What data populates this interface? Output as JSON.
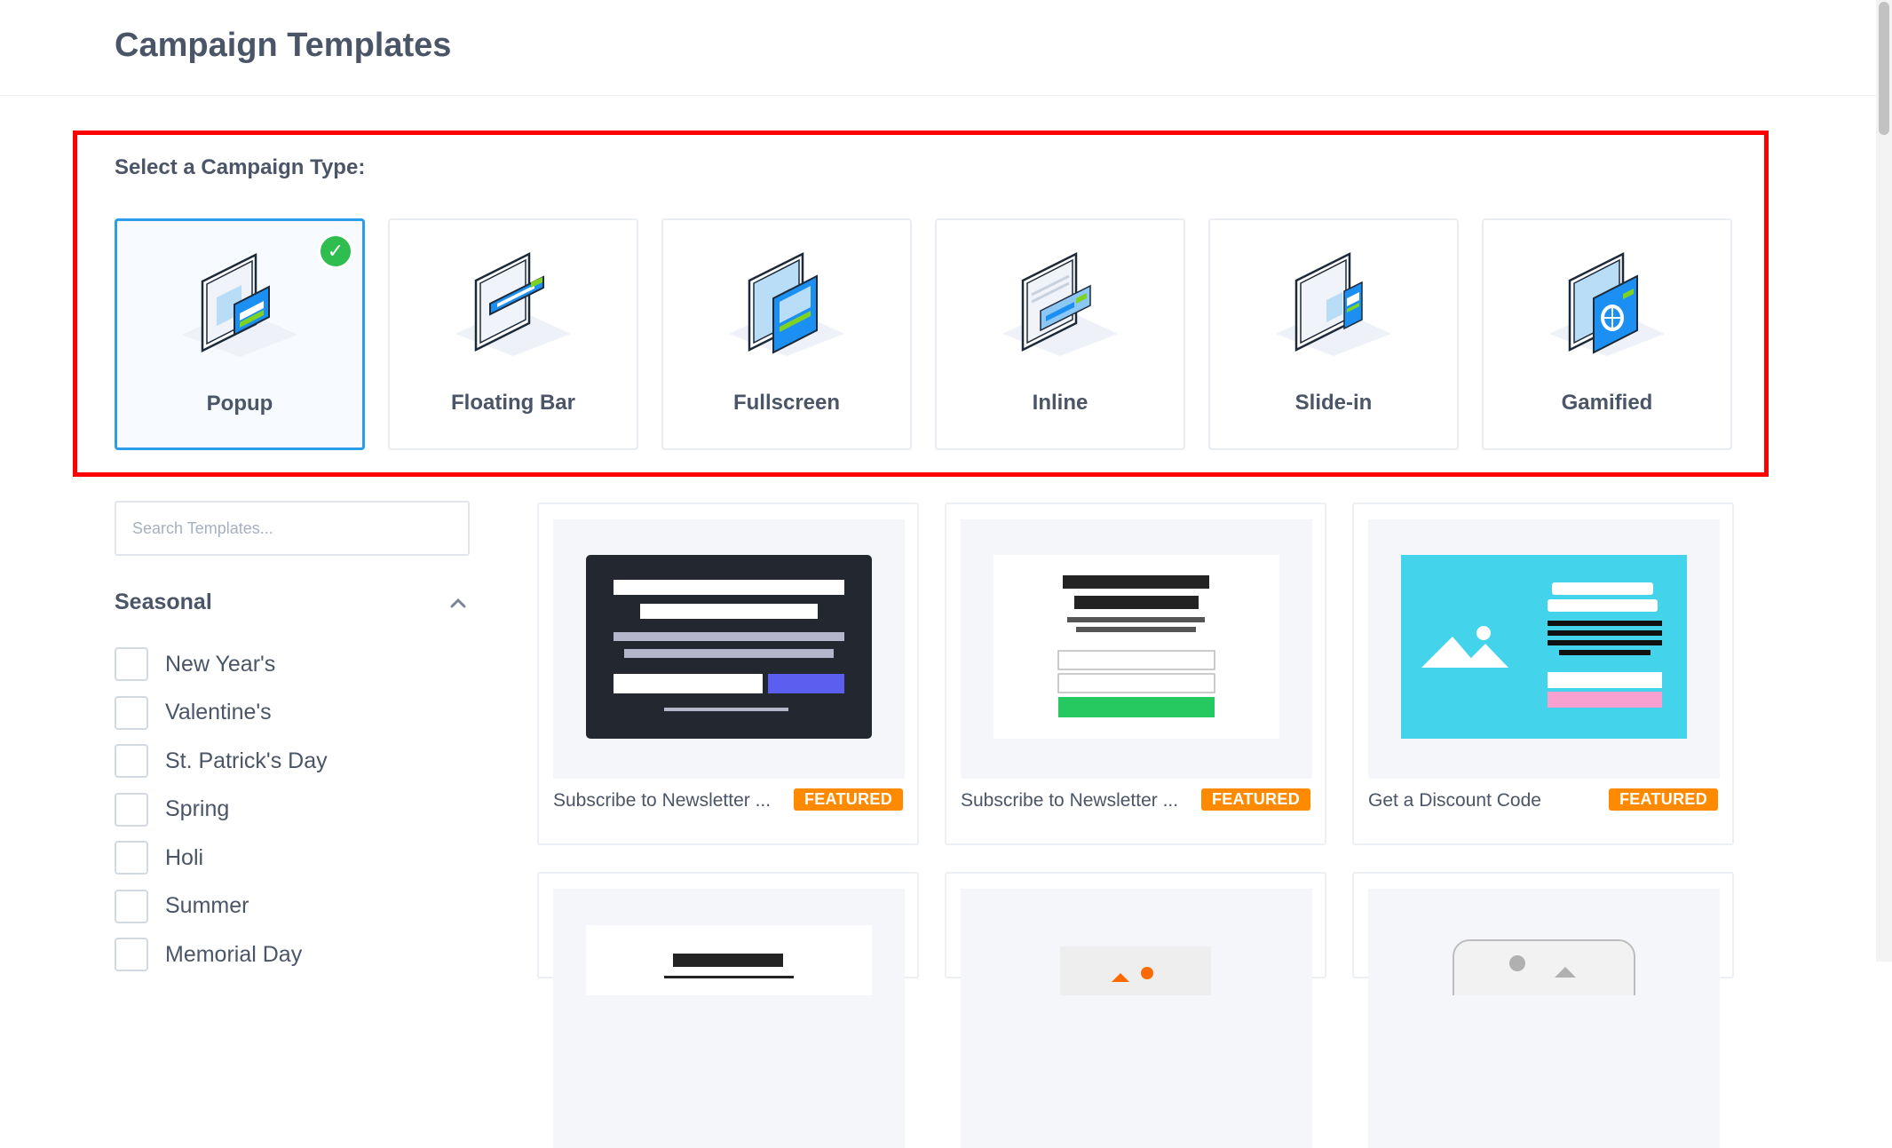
{
  "header": {
    "title": "Campaign Templates"
  },
  "campaign_types": {
    "heading": "Select a Campaign Type:",
    "items": [
      {
        "label": "Popup",
        "icon": "popup-icon",
        "selected": true
      },
      {
        "label": "Floating Bar",
        "icon": "floating-bar-icon",
        "selected": false
      },
      {
        "label": "Fullscreen",
        "icon": "fullscreen-icon",
        "selected": false
      },
      {
        "label": "Inline",
        "icon": "inline-icon",
        "selected": false
      },
      {
        "label": "Slide-in",
        "icon": "slide-in-icon",
        "selected": false
      },
      {
        "label": "Gamified",
        "icon": "gamified-icon",
        "selected": false
      }
    ]
  },
  "sidebar": {
    "search_placeholder": "Search Templates...",
    "filter_group": {
      "title": "Seasonal",
      "expanded": true
    },
    "filters": [
      {
        "label": "New Year's",
        "checked": false
      },
      {
        "label": "Valentine's",
        "checked": false
      },
      {
        "label": "St. Patrick's Day",
        "checked": false
      },
      {
        "label": "Spring",
        "checked": false
      },
      {
        "label": "Holi",
        "checked": false
      },
      {
        "label": "Summer",
        "checked": false
      },
      {
        "label": "Memorial Day",
        "checked": false
      }
    ]
  },
  "templates": [
    {
      "name": "Subscribe to Newsletter ...",
      "badge": "FEATURED"
    },
    {
      "name": "Subscribe to Newsletter ...",
      "badge": "FEATURED"
    },
    {
      "name": "Get a Discount Code",
      "badge": "FEATURED"
    }
  ],
  "colors": {
    "accent": "#2c9dea",
    "featured": "#ff8a00",
    "selected_check": "#2ebd4e",
    "highlight_border": "#ff0000"
  }
}
